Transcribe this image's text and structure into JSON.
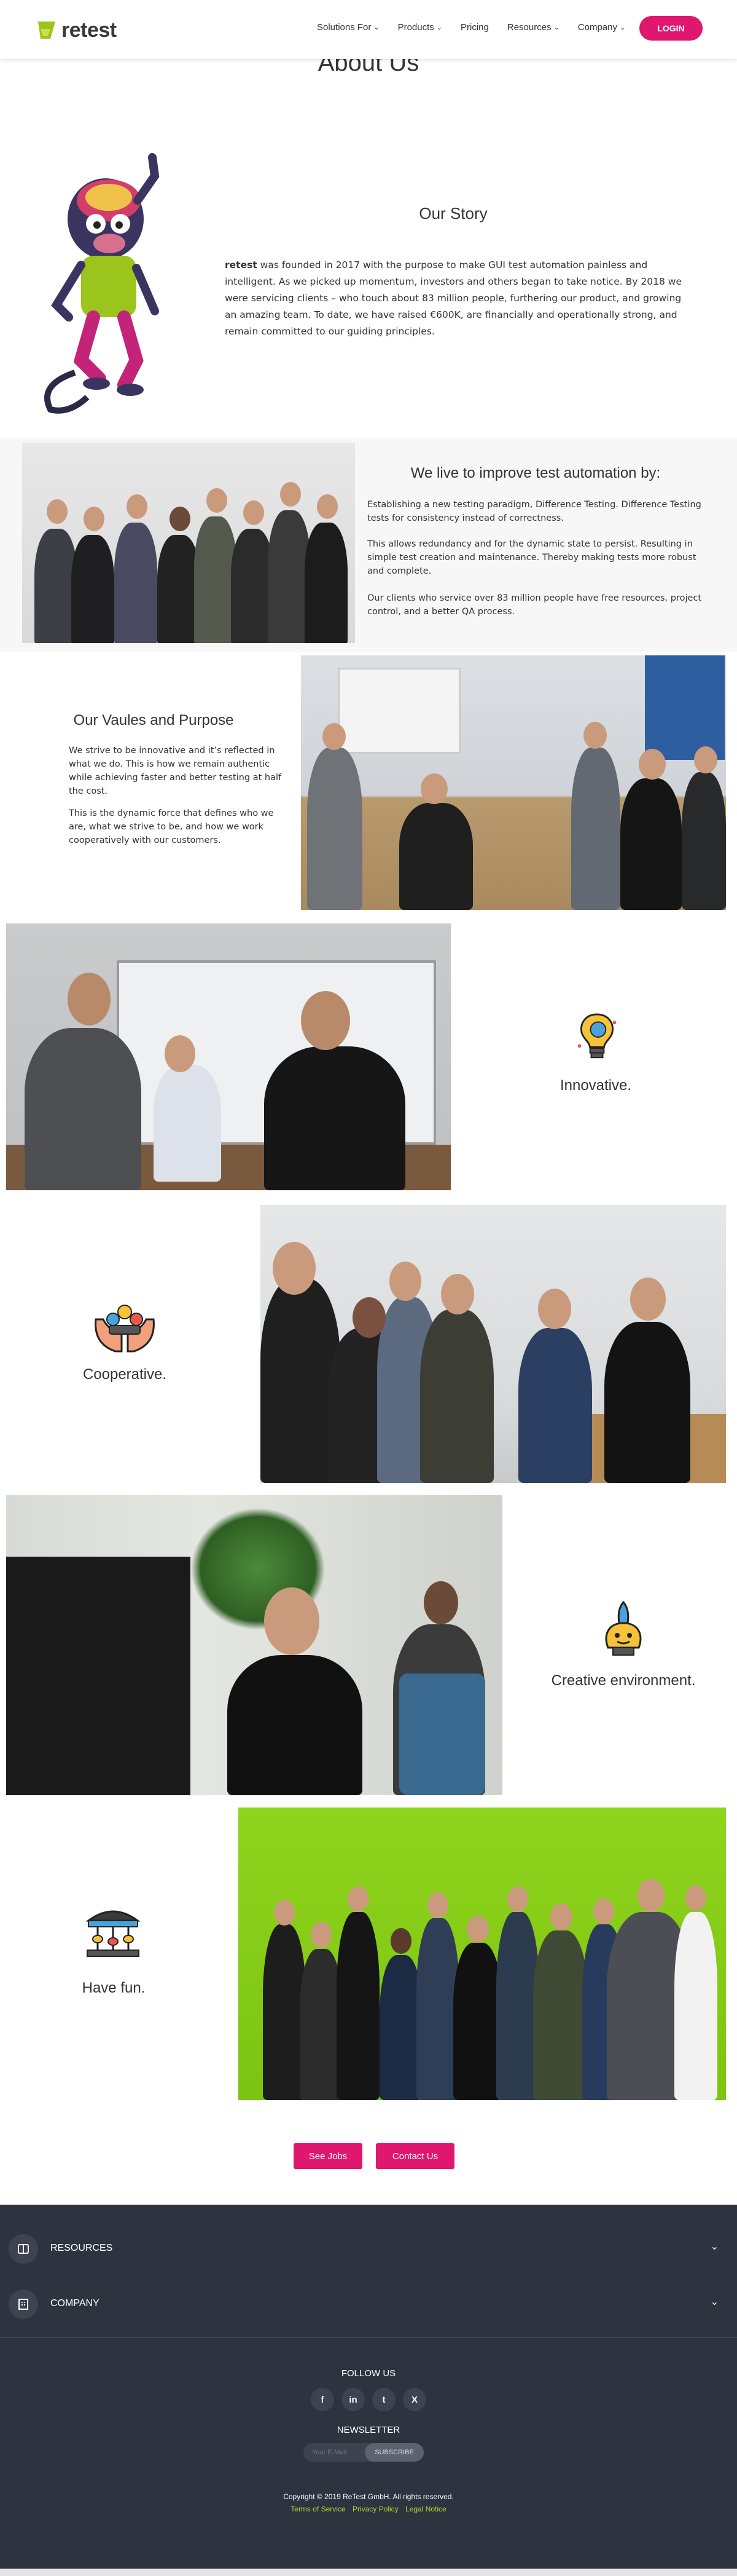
{
  "brand": {
    "name": "retest",
    "accent": "#e0176e",
    "lime": "#b8d431"
  },
  "nav": {
    "items": [
      {
        "label": "Solutions For",
        "dropdown": true
      },
      {
        "label": "Products",
        "dropdown": true
      },
      {
        "label": "Pricing",
        "dropdown": false
      },
      {
        "label": "Resources",
        "dropdown": true
      },
      {
        "label": "Company",
        "dropdown": true
      }
    ],
    "login_label": "LOGIN"
  },
  "page": {
    "heading": "About Us"
  },
  "story": {
    "title": "Our Story",
    "brand_word": "retest",
    "text": " was founded in 2017 with the purpose to make GUI test automation painless and intelligent. As we picked up momentum, investors and others began to take notice. By 2018 we were servicing clients – who touch about 83 million people, furthering our product, and growing an amazing team. To date, we have raised €600K, are financially and operationally strong, and remain committed to our guiding principles."
  },
  "improve": {
    "title": "We live to improve test automation by:",
    "paragraphs": [
      "Establishing a new testing paradigm, Difference Testing. Difference Testing tests for consistency instead of correctness.",
      "This allows redundancy and for the dynamic state to persist. Resulting in simple test creation and maintenance. Thereby making tests more robust and complete.",
      "Our clients who service over 83 million people have free resources, project control, and a better QA process."
    ]
  },
  "values": {
    "title": "Our Vaules and Purpose",
    "paragraphs": [
      "We strive to be innovative and it’s reflected in what we do. This is how we remain authentic while achieving faster and better testing at half the cost.",
      "This is the dynamic force that defines who we are, what we strive to be, and how we work cooperatively with our customers."
    ]
  },
  "features": [
    {
      "label": "Innovative.",
      "icon": "lightbulb-brain-icon"
    },
    {
      "label": "Cooperative.",
      "icon": "hands-team-icon"
    },
    {
      "label": "Creative environment.",
      "icon": "rocket-head-icon"
    },
    {
      "label": "Have fun.",
      "icon": "carousel-icon"
    }
  ],
  "cta": {
    "jobs_label": "See Jobs",
    "contact_label": "Contact Us"
  },
  "footer": {
    "sections": [
      {
        "label": "RESOURCES",
        "icon": "book-icon"
      },
      {
        "label": "COMPANY",
        "icon": "building-icon"
      }
    ],
    "follow_title": "FOLLOW US",
    "socials": [
      {
        "name": "facebook-icon",
        "glyph": "f"
      },
      {
        "name": "linkedin-icon",
        "glyph": "in"
      },
      {
        "name": "twitter-icon",
        "glyph": "t"
      },
      {
        "name": "xing-icon",
        "glyph": "X"
      }
    ],
    "newsletter_title": "NEWSLETTER",
    "email_placeholder": "Your E-Mail",
    "subscribe_label": "SUBSCRIBE",
    "copyright": "Copyright © 2019 ReTest GmbH. All rights reserved.",
    "links": [
      "Terms of Service",
      "Privacy Policy",
      "Legal Notice"
    ]
  }
}
